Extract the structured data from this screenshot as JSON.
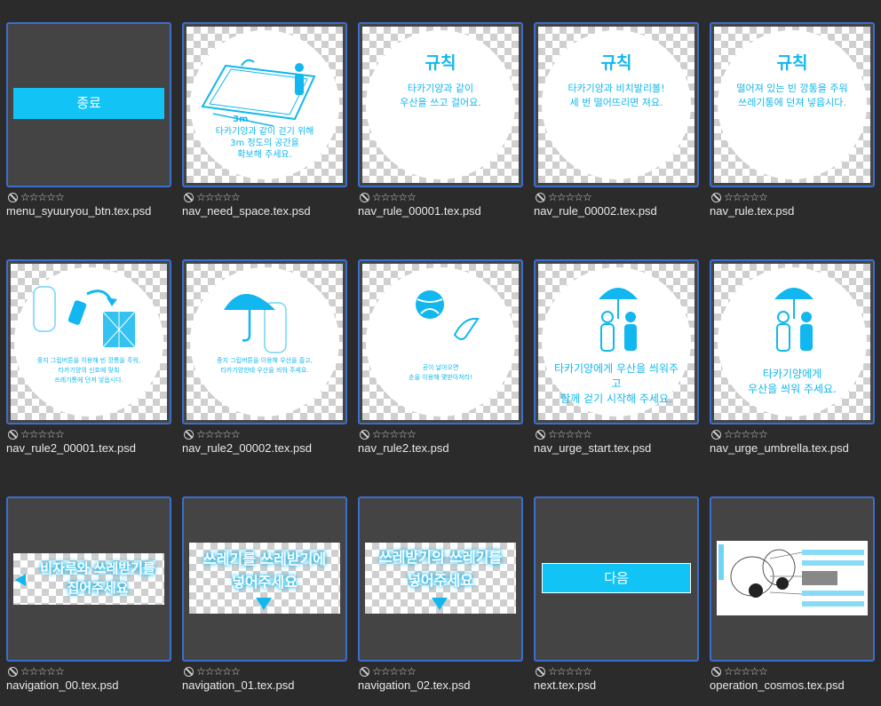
{
  "tiles": [
    {
      "file": "menu_syuuryou_btn.tex.psd",
      "btn": "종료"
    },
    {
      "file": "nav_need_space.tex.psd",
      "label": "3m",
      "text": "타카기양과 같이 걷기 위해\n3m 정도의 공간을\n확보해 주세요."
    },
    {
      "file": "nav_rule_00001.tex.psd",
      "title": "규칙",
      "text": "타카기양과 같이\n우산을 쓰고 걸어요."
    },
    {
      "file": "nav_rule_00002.tex.psd",
      "title": "규칙",
      "text": "타카기양과 비치발리볼!\n세 번 떨어뜨리면 져요."
    },
    {
      "file": "nav_rule.tex.psd",
      "title": "규칙",
      "text": "떨어져 있는 빈 깡통을 주워\n쓰레기통에 던져 넣읍시다."
    },
    {
      "file": "nav_rule2_00001.tex.psd",
      "text": "중지 그립버튼을 이용해 빈 깡통을 주워,\n타카기양의 신호에 맞춰\n쓰레기통에 던져 넣읍시다."
    },
    {
      "file": "nav_rule2_00002.tex.psd",
      "text": "중지 그립버튼을 이용해 우산을 줍고,\n타카기양한테 우산을 씌워 주세요."
    },
    {
      "file": "nav_rule2.tex.psd",
      "text": "공이 날아오면\n손을 이용해 몇받아쳐라!"
    },
    {
      "file": "nav_urge_start.tex.psd",
      "text": "타카기양에게 우산을 씌워주고\n함께 걷기 시작해 주세요."
    },
    {
      "file": "nav_urge_umbrella.tex.psd",
      "text": "타카기양에게\n우산을 씌워 주세요."
    },
    {
      "file": "navigation_00.tex.psd",
      "text": "비자루와 쓰레받기를\n집어주세요"
    },
    {
      "file": "navigation_01.tex.psd",
      "text": "쓰레기를 쓰레받기에\n넣어주세요"
    },
    {
      "file": "navigation_02.tex.psd",
      "text": "쓰레받기의 쓰레기를\n넣어주세요"
    },
    {
      "file": "next.tex.psd",
      "btn": "다음"
    },
    {
      "file": "operation_cosmos.tex.psd"
    }
  ],
  "rating_stars": "☆☆☆☆☆",
  "colors": {
    "accent": "#11b7ee",
    "selection_border": "#3b6fcf",
    "background": "#2b2b2b",
    "tile_bg": "#444444"
  }
}
